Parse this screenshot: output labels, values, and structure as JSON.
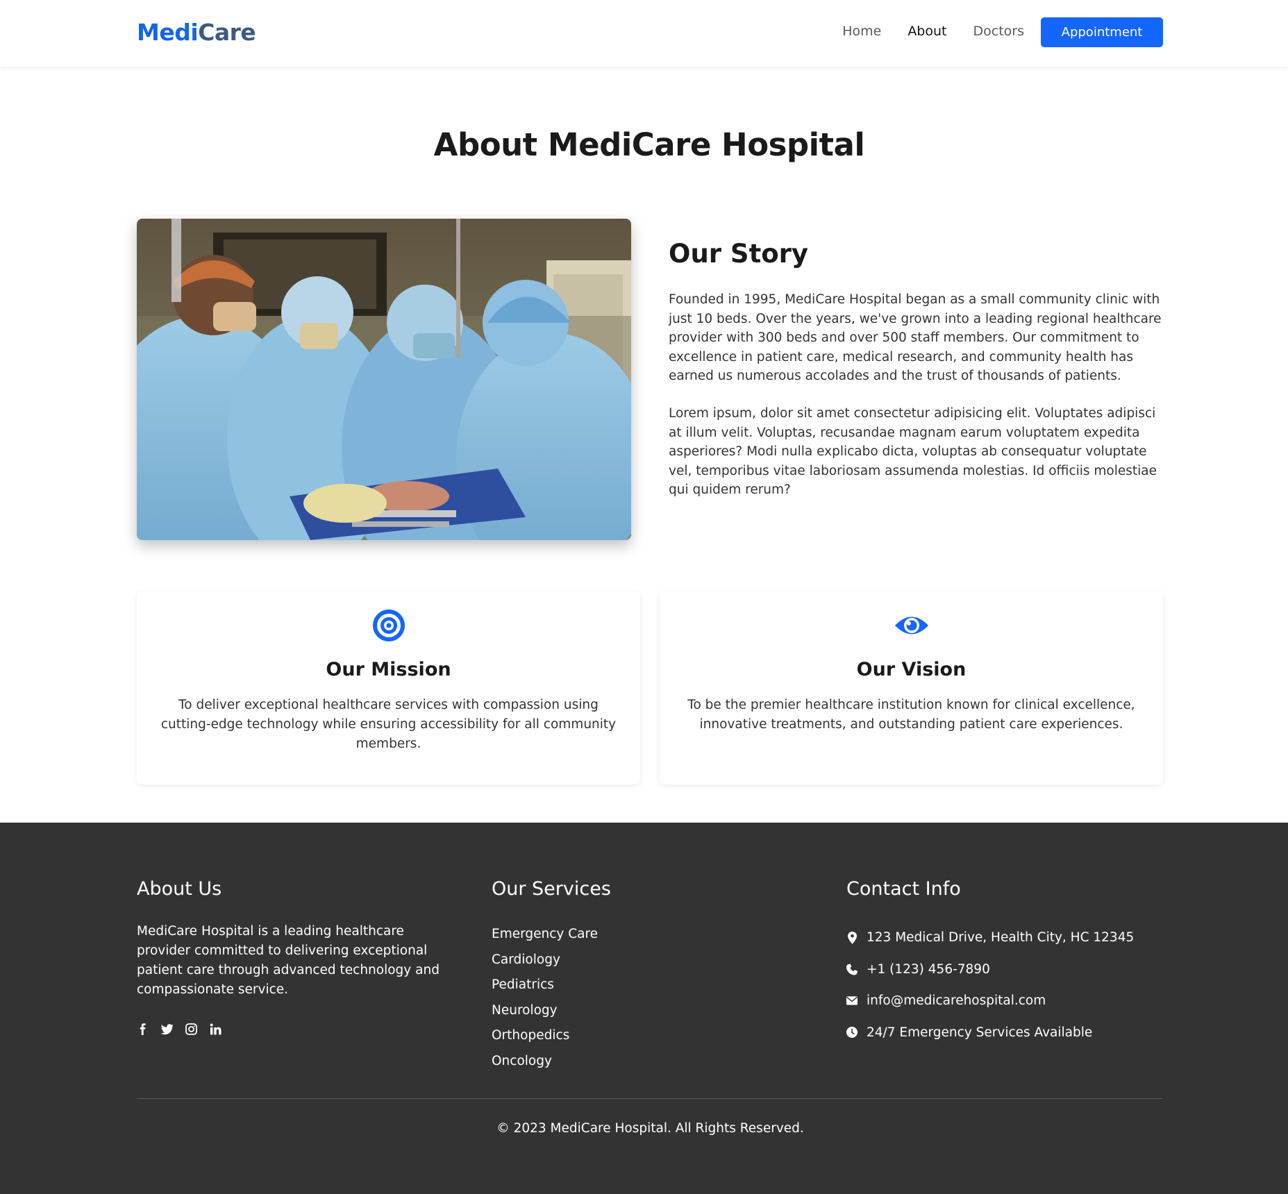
{
  "brand": {
    "part1": "Medi",
    "part2": "Care"
  },
  "nav": {
    "links": [
      "Home",
      "About",
      "Doctors"
    ],
    "active": "About",
    "cta": "Appointment"
  },
  "page": {
    "title": "About MediCare Hospital"
  },
  "story": {
    "title": "Our Story",
    "p1": "Founded in 1995, MediCare Hospital began as a small community clinic with just 10 beds. Over the years, we've grown into a leading regional healthcare provider with 300 beds and over 500 staff members. Our commitment to excellence in patient care, medical research, and community health has earned us numerous accolades and the trust of thousands of patients.",
    "p2": "Lorem ipsum, dolor sit amet consectetur adipisicing elit. Voluptates adipisci at illum velit. Voluptas, recusandae magnam earum voluptatem expedita asperiores? Modi nulla explicabo dicta, voluptas ab consequatur voluptate vel, temporibus vitae laboriosam assumenda molestias. Id officiis molestiae qui quidem rerum?"
  },
  "mission": {
    "icon": "target-icon",
    "title": "Our Mission",
    "text": "To deliver exceptional healthcare services with compassion using cutting-edge technology while ensuring accessibility for all community members."
  },
  "vision": {
    "icon": "eye-icon",
    "title": "Our Vision",
    "text": "To be the premier healthcare institution known for clinical excellence, innovative treatments, and outstanding patient care experiences."
  },
  "footer": {
    "about": {
      "title": "About Us",
      "text": "MediCare Hospital is a leading healthcare provider committed to delivering exceptional patient care through advanced technology and compassionate service.",
      "socials": [
        "facebook-icon",
        "twitter-icon",
        "instagram-icon",
        "linkedin-icon"
      ]
    },
    "services": {
      "title": "Our Services",
      "items": [
        "Emergency Care",
        "Cardiology",
        "Pediatrics",
        "Neurology",
        "Orthopedics",
        "Oncology"
      ]
    },
    "contact": {
      "title": "Contact Info",
      "address": "123 Medical Drive, Health City, HC 12345",
      "phone": "+1 (123) 456-7890",
      "email": "info@medicarehospital.com",
      "hours": "24/7 Emergency Services Available"
    },
    "copyright": "© 2023 MediCare Hospital. All Rights Reserved."
  },
  "colors": {
    "accent": "#1565ff",
    "footer_bg": "#333333",
    "logo_secondary": "#3d5a80"
  }
}
